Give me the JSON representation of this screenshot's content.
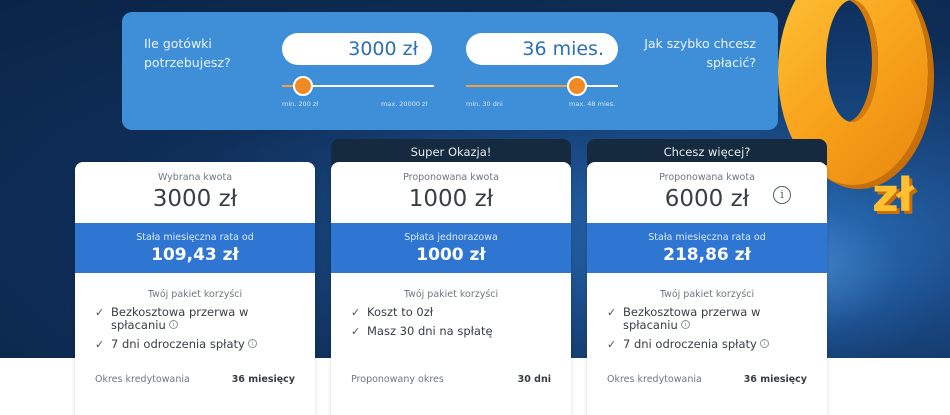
{
  "calculator": {
    "question_amount": "Ile gotówki potrzebujesz?",
    "question_period": "Jak szybko chcesz spłacić?",
    "amount_value": "3000 zł",
    "period_value": "36 mies.",
    "amount_min": "min. 200 zł",
    "amount_max": "max. 20000 zł",
    "period_min": "min. 30 dni",
    "period_max": "max. 48 mies.",
    "amount_fraction": 0.14,
    "period_fraction": 0.73
  },
  "decoration": {
    "zl_logo": "zł"
  },
  "cards": [
    {
      "tab": "",
      "top_label": "Wybrana kwota",
      "top_amount": "3000 zł",
      "rate_label": "Stała miesięczna rata od",
      "rate_value": "109,43 zł",
      "package_label": "Twój pakiet korzyści",
      "benefits": [
        "Bezkosztowa przerwa w spłacaniu",
        "7 dni odroczenia spłaty"
      ],
      "footer_label": "Okres kredytowania",
      "footer_value": "36 miesięcy"
    },
    {
      "tab": "Super Okazja!",
      "top_label": "Proponowana kwota",
      "top_amount": "1000 zł",
      "rate_label": "Spłata jednorazowa",
      "rate_value": "1000 zł",
      "package_label": "Twój pakiet korzyści",
      "benefits": [
        "Koszt to 0zł",
        "Masz 30 dni na spłatę"
      ],
      "footer_label": "Proponowany okres",
      "footer_value": "30 dni"
    },
    {
      "tab": "Chcesz więcej?",
      "top_label": "Proponowana kwota",
      "top_amount": "6000 zł",
      "rate_label": "Stała miesięczna rata od",
      "rate_value": "218,86 zł",
      "package_label": "Twój pakiet korzyści",
      "benefits": [
        "Bezkosztowa przerwa w spłacaniu",
        "7 dni odroczenia spłaty"
      ],
      "footer_label": "Okres kredytowania",
      "footer_value": "36 miesięcy"
    }
  ],
  "colors": {
    "accent_blue": "#2f75d2",
    "panel_blue": "#3f8fd8",
    "slider_orange": "#f08a24",
    "dark_navy": "#0f2e58"
  },
  "icons": {
    "check": "check-icon",
    "info": "info-icon"
  }
}
